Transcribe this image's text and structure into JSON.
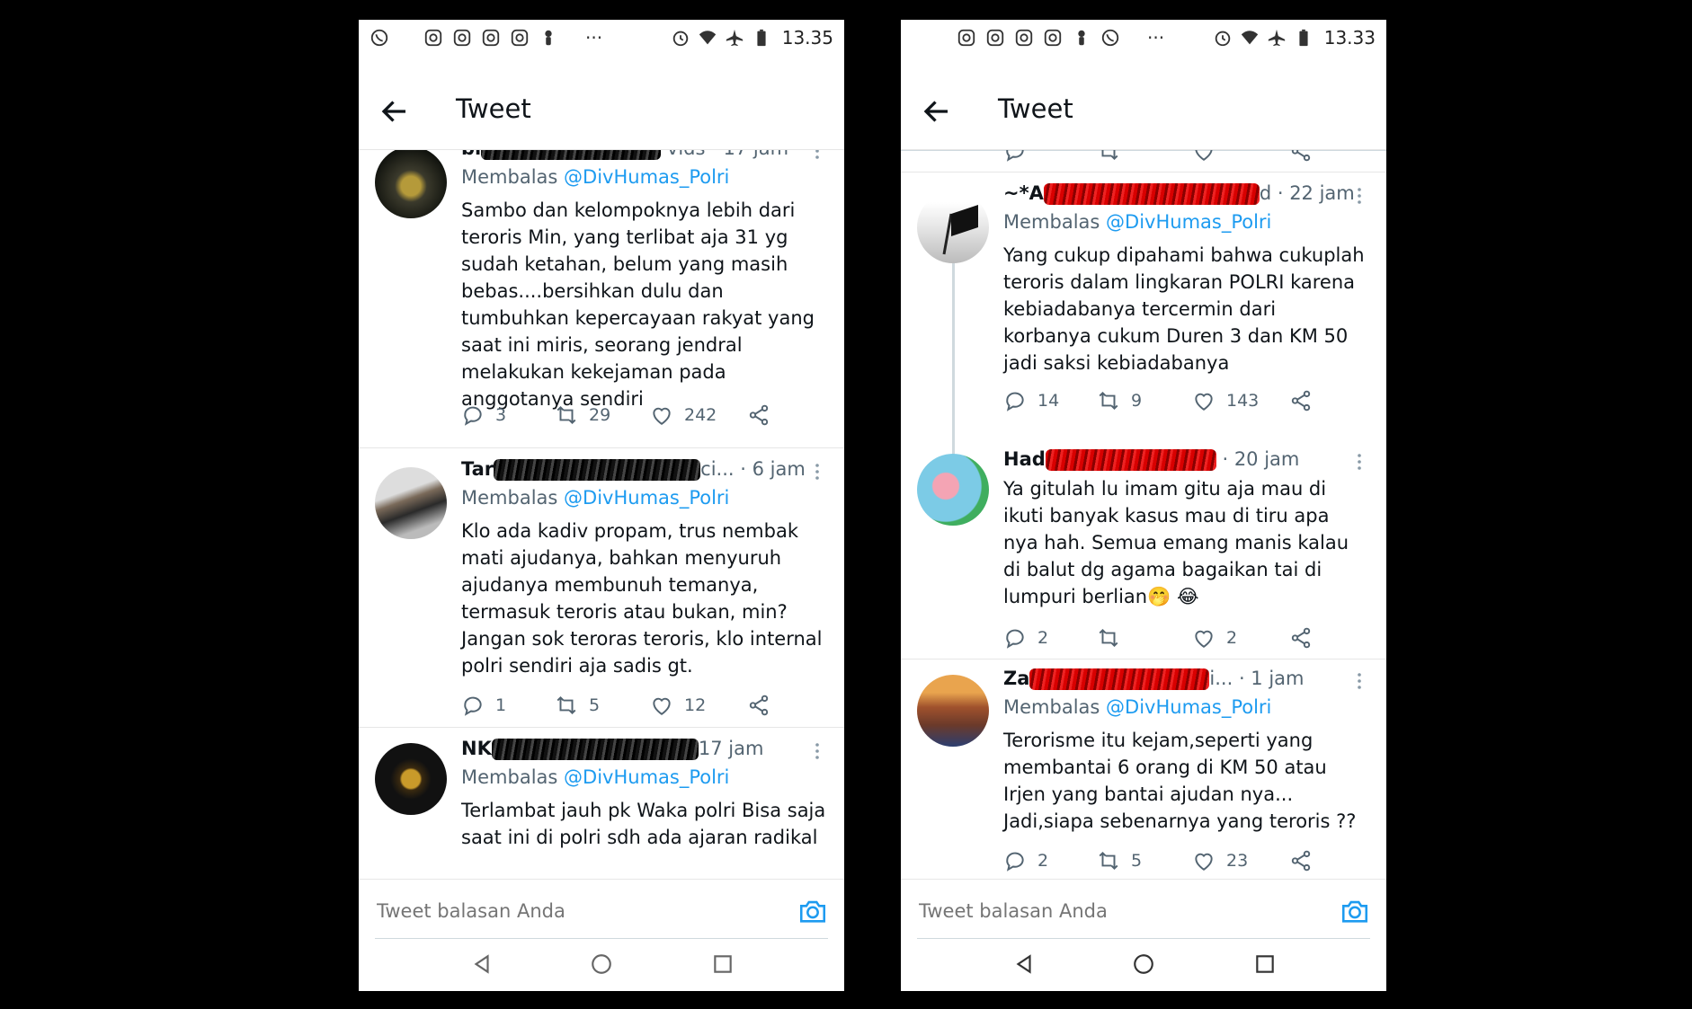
{
  "colors": {
    "accent": "#1d9bf0",
    "text": "#0f1419",
    "muted": "#536471",
    "redaction": "#d80000"
  },
  "left": {
    "status_time": "13.35",
    "title": "Tweet",
    "tweets": [
      {
        "name": "bi",
        "meta": "vids · 17 jam",
        "reply_prefix": "Membalas",
        "reply_to": "@DivHumas_Polri",
        "text": "Sambo dan kelompoknya lebih dari teroris Min, yang terlibat aja 31 yg sudah ketahan, belum yang masih bebas....bersihkan dulu dan tumbuhkan kepercayaan rakyat yang saat ini miris, seorang jendral melakukan kekejaman pada anggotanya sendiri",
        "replies": "3",
        "retweets": "29",
        "likes": "242"
      },
      {
        "name": "Tar",
        "meta": "ci... · 6 jam",
        "reply_prefix": "Membalas",
        "reply_to": "@DivHumas_Polri",
        "text": "Klo ada kadiv propam, trus nembak mati ajudanya, bahkan menyuruh ajudanya membunuh temanya, termasuk teroris atau bukan, min? Jangan sok teroras teroris, klo internal polri sendiri aja sadis gt.",
        "replies": "1",
        "retweets": "5",
        "likes": "12"
      },
      {
        "name": "NK",
        "meta": "17 jam",
        "reply_prefix": "Membalas",
        "reply_to": "@DivHumas_Polri",
        "text": "Terlambat jauh pk Waka polri Bisa saja saat ini di polri sdh ada ajaran radikal"
      }
    ],
    "composer_placeholder": "Tweet balasan Anda"
  },
  "right": {
    "status_time": "13.33",
    "title": "Tweet",
    "tweets": [
      {
        "name": "~*A",
        "meta": "d · 22 jam",
        "reply_prefix": "Membalas",
        "reply_to": "@DivHumas_Polri",
        "text": "Yang cukup dipahami bahwa cukuplah teroris dalam lingkaran POLRI karena kebiadabanya tercermin dari korbanya cukum Duren 3 dan KM 50 jadi saksi kebiadabanya",
        "replies": "14",
        "retweets": "9",
        "likes": "143"
      },
      {
        "name": "Had",
        "meta": "· 20 jam",
        "text": "Ya gitulah lu imam gitu aja mau di ikuti banyak kasus mau di tiru apa nya hah. Semua emang manis kalau di balut dg agama bagaikan tai di lumpuri berlian🤭 😂",
        "replies": "2",
        "retweets": "",
        "likes": "2"
      },
      {
        "name": "Za",
        "meta": "i... · 1 jam",
        "reply_prefix": "Membalas",
        "reply_to": "@DivHumas_Polri",
        "text": "Terorisme itu kejam,seperti yang membantai 6 orang di KM 50 atau Irjen yang bantai ajudan nya... Jadi,siapa sebenarnya yang teroris ??",
        "replies": "2",
        "retweets": "5",
        "likes": "23"
      }
    ],
    "composer_placeholder": "Tweet balasan Anda"
  }
}
